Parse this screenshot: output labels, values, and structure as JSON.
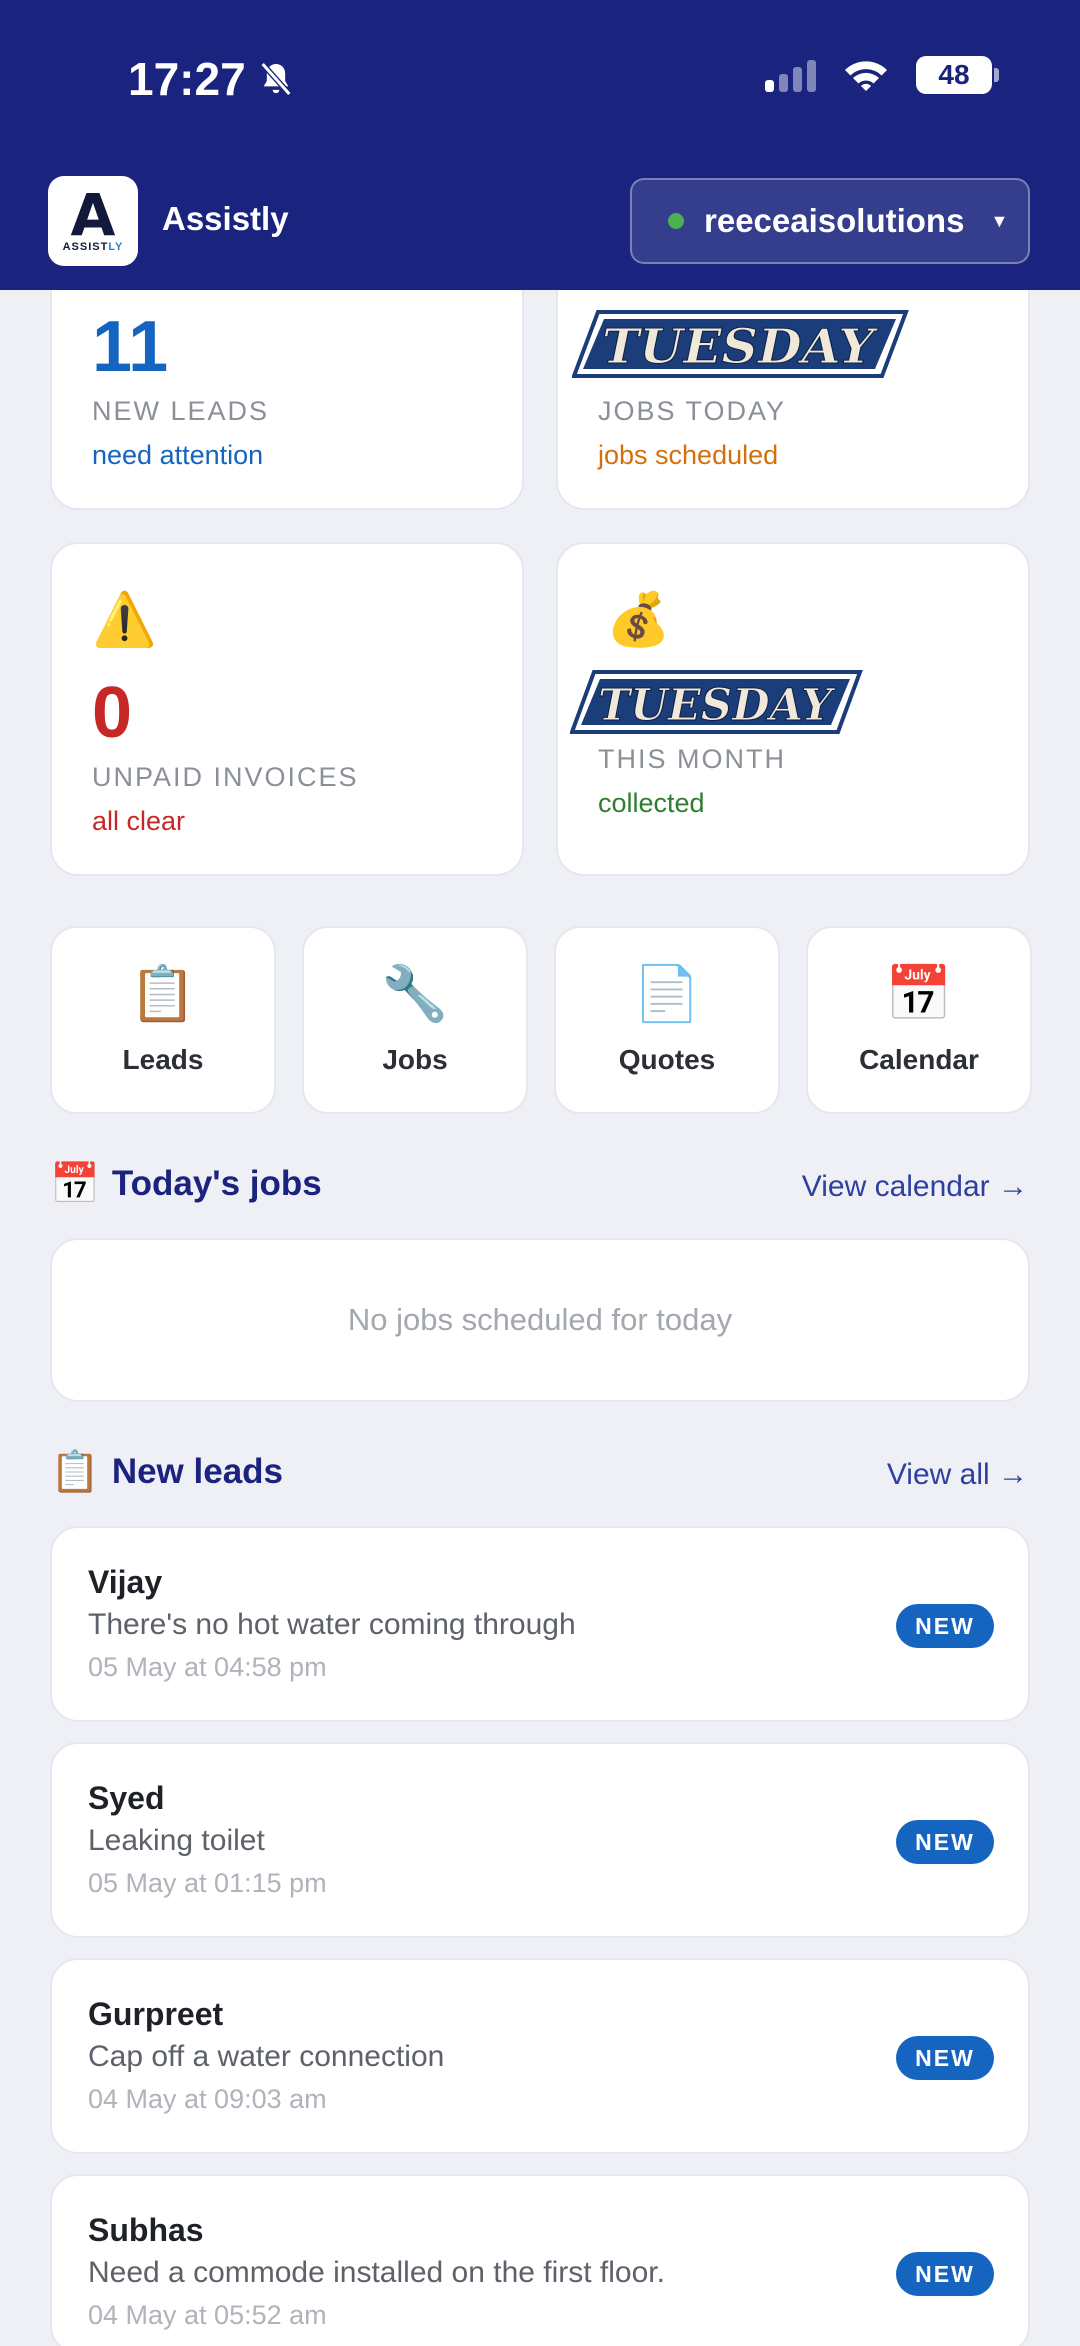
{
  "status_bar": {
    "time": "17:27",
    "battery": "48"
  },
  "header": {
    "logo_letter": "A",
    "logo_word_a": "ASSIST",
    "logo_word_b": "LY",
    "app_name": "Assistly",
    "account": "reeceaisolutions"
  },
  "stats": {
    "new_leads": {
      "value": "11",
      "label": "NEW LEADS",
      "sub": "need attention"
    },
    "jobs_today": {
      "value_art": "TUESDAY",
      "label": "JOBS TODAY",
      "sub": "jobs scheduled"
    },
    "unpaid_invoices": {
      "icon": "⚠️",
      "value": "0",
      "label": "UNPAID INVOICES",
      "sub": "all clear"
    },
    "this_month": {
      "icon": "💰",
      "value_art": "TUESDAY",
      "label": "THIS MONTH",
      "sub": "collected"
    }
  },
  "quick_actions": [
    {
      "icon": "📋",
      "label": "Leads"
    },
    {
      "icon": "🔧",
      "label": "Jobs"
    },
    {
      "icon": "📄",
      "label": "Quotes"
    },
    {
      "icon": "📅",
      "label": "Calendar"
    }
  ],
  "todays_jobs": {
    "icon": "📅",
    "title": "Today's jobs",
    "link": "View calendar →",
    "empty": "No jobs scheduled for today"
  },
  "new_leads": {
    "icon": "📋",
    "title": "New leads",
    "link": "View all →",
    "items": [
      {
        "name": "Vijay",
        "desc": "There's no hot water coming through",
        "time": "05 May at 04:58 pm",
        "badge": "NEW"
      },
      {
        "name": "Syed",
        "desc": "Leaking toilet",
        "time": "05 May at 01:15 pm",
        "badge": "NEW"
      },
      {
        "name": "Gurpreet",
        "desc": "Cap off a water connection",
        "time": "04 May at 09:03 am",
        "badge": "NEW"
      },
      {
        "name": "Subhas",
        "desc": "Need a commode installed on the first floor.",
        "time": "04 May at 05:52 am",
        "badge": "NEW"
      }
    ]
  },
  "colors": {
    "header_bg": "#1a237e",
    "leads_blue": "#1565c0",
    "jobs_orange": "#d4700a",
    "invoices_red": "#c62828",
    "collected_green": "#2e7d32"
  }
}
